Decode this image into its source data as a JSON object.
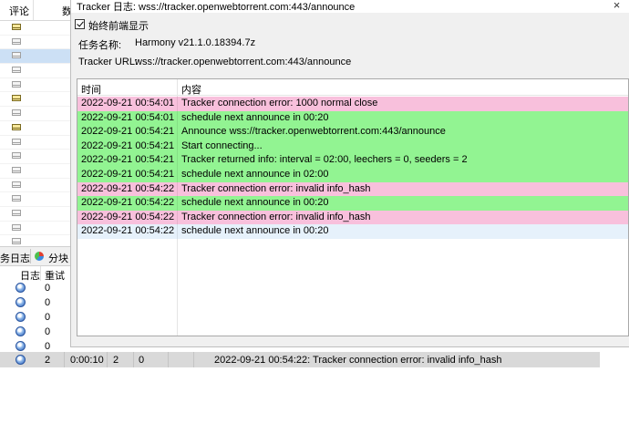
{
  "background": {
    "header_col1": "评论",
    "header_col2": "数",
    "mail_rows": [
      {
        "icon": "mail-open-icon",
        "open": true,
        "selected": false
      },
      {
        "icon": "mail-icon",
        "open": false,
        "selected": false
      },
      {
        "icon": "mail-icon",
        "open": false,
        "selected": true
      },
      {
        "icon": "mail-icon",
        "open": false,
        "selected": false
      },
      {
        "icon": "mail-icon",
        "open": false,
        "selected": false
      },
      {
        "icon": "mail-open-icon",
        "open": true,
        "selected": false
      },
      {
        "icon": "mail-icon",
        "open": false,
        "selected": false
      },
      {
        "icon": "mail-open-icon",
        "open": true,
        "selected": false
      },
      {
        "icon": "mail-icon",
        "open": false,
        "selected": false
      },
      {
        "icon": "mail-icon",
        "open": false,
        "selected": false
      },
      {
        "icon": "mail-icon",
        "open": false,
        "selected": false
      },
      {
        "icon": "mail-icon",
        "open": false,
        "selected": false
      },
      {
        "icon": "mail-icon",
        "open": false,
        "selected": false
      },
      {
        "icon": "mail-icon",
        "open": false,
        "selected": false
      },
      {
        "icon": "mail-icon",
        "open": false,
        "selected": false
      },
      {
        "icon": "mail-icon",
        "open": false,
        "selected": false
      }
    ],
    "tabs": {
      "task_log": "务日志",
      "blocks": "分块"
    },
    "log_header": {
      "col_log": "日志",
      "col_retry": "重试"
    },
    "log_rows": [
      "0",
      "0",
      "0",
      "0",
      "0"
    ],
    "status": {
      "count": "2",
      "elapsed": "0:00:10",
      "num1": "2",
      "num2": "0",
      "message": "2022-09-21 00:54:22: Tracker connection error: invalid info_hash"
    }
  },
  "dialog": {
    "title": "Tracker 日志: wss://tracker.openwebtorrent.com:443/announce",
    "close_glyph": "×",
    "always_on_top_label": "始终前端显示",
    "task_name_label": "任务名称:",
    "task_name_value": "Harmony v21.1.0.18394.7z",
    "tracker_url_label": "Tracker URL:",
    "tracker_url_value": "wss://tracker.openwebtorrent.com:443/announce",
    "table": {
      "col_time": "时间",
      "col_content": "内容",
      "rows": [
        {
          "time": "2022-09-21 00:54:01",
          "message": "Tracker connection error: 1000 normal close",
          "color": "pink"
        },
        {
          "time": "2022-09-21 00:54:01",
          "message": "schedule next announce in 00:20",
          "color": "green"
        },
        {
          "time": "2022-09-21 00:54:21",
          "message": "Announce wss://tracker.openwebtorrent.com:443/announce",
          "color": "green"
        },
        {
          "time": "2022-09-21 00:54:21",
          "message": "Start connecting...",
          "color": "green"
        },
        {
          "time": "2022-09-21 00:54:21",
          "message": "Tracker returned info: interval = 02:00, leechers = 0, seeders = 2",
          "color": "green"
        },
        {
          "time": "2022-09-21 00:54:21",
          "message": "schedule next announce in 02:00",
          "color": "green"
        },
        {
          "time": "2022-09-21 00:54:22",
          "message": "Tracker connection error: invalid info_hash",
          "color": "pink"
        },
        {
          "time": "2022-09-21 00:54:22",
          "message": "schedule next announce in 00:20",
          "color": "green"
        },
        {
          "time": "2022-09-21 00:54:22",
          "message": "Tracker connection error: invalid info_hash",
          "color": "pink"
        },
        {
          "time": "2022-09-21 00:54:22",
          "message": "schedule next announce in 00:20",
          "color": "blue"
        }
      ]
    }
  },
  "colors": {
    "error_row": "#f8c0dc",
    "ok_row": "#92f492",
    "selected_row": "#e6f1fb"
  }
}
